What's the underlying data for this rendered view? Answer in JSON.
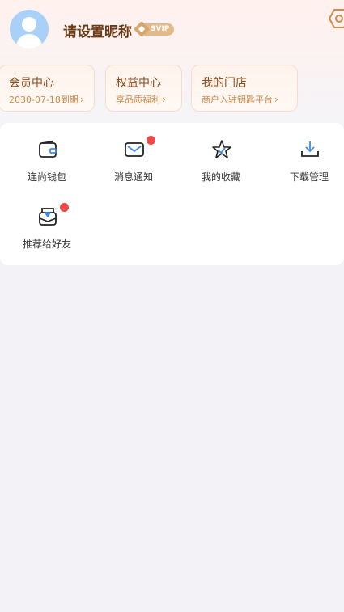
{
  "profile": {
    "nickname": "请设置昵称",
    "badge": "SVIP"
  },
  "cards": [
    {
      "title": "会员中心",
      "sub": "2030-07-18到期"
    },
    {
      "title": "权益中心",
      "sub": "享品质福利"
    },
    {
      "title": "我的门店",
      "sub": "商户入驻钥匙平台"
    }
  ],
  "grid": [
    {
      "label": "连尚钱包",
      "icon": "wallet-icon",
      "badge": false
    },
    {
      "label": "消息通知",
      "icon": "mail-icon",
      "badge": true
    },
    {
      "label": "我的收藏",
      "icon": "star-icon",
      "badge": false
    },
    {
      "label": "下载管理",
      "icon": "download-icon",
      "badge": false
    },
    {
      "label": "推荐给好友",
      "icon": "share-envelope-icon",
      "badge": true
    }
  ],
  "colors": {
    "accent_brown": "#6a3a14",
    "accent_orange": "#d08a4a",
    "icon_blue": "#3d8be8",
    "badge_red": "#f04848"
  }
}
